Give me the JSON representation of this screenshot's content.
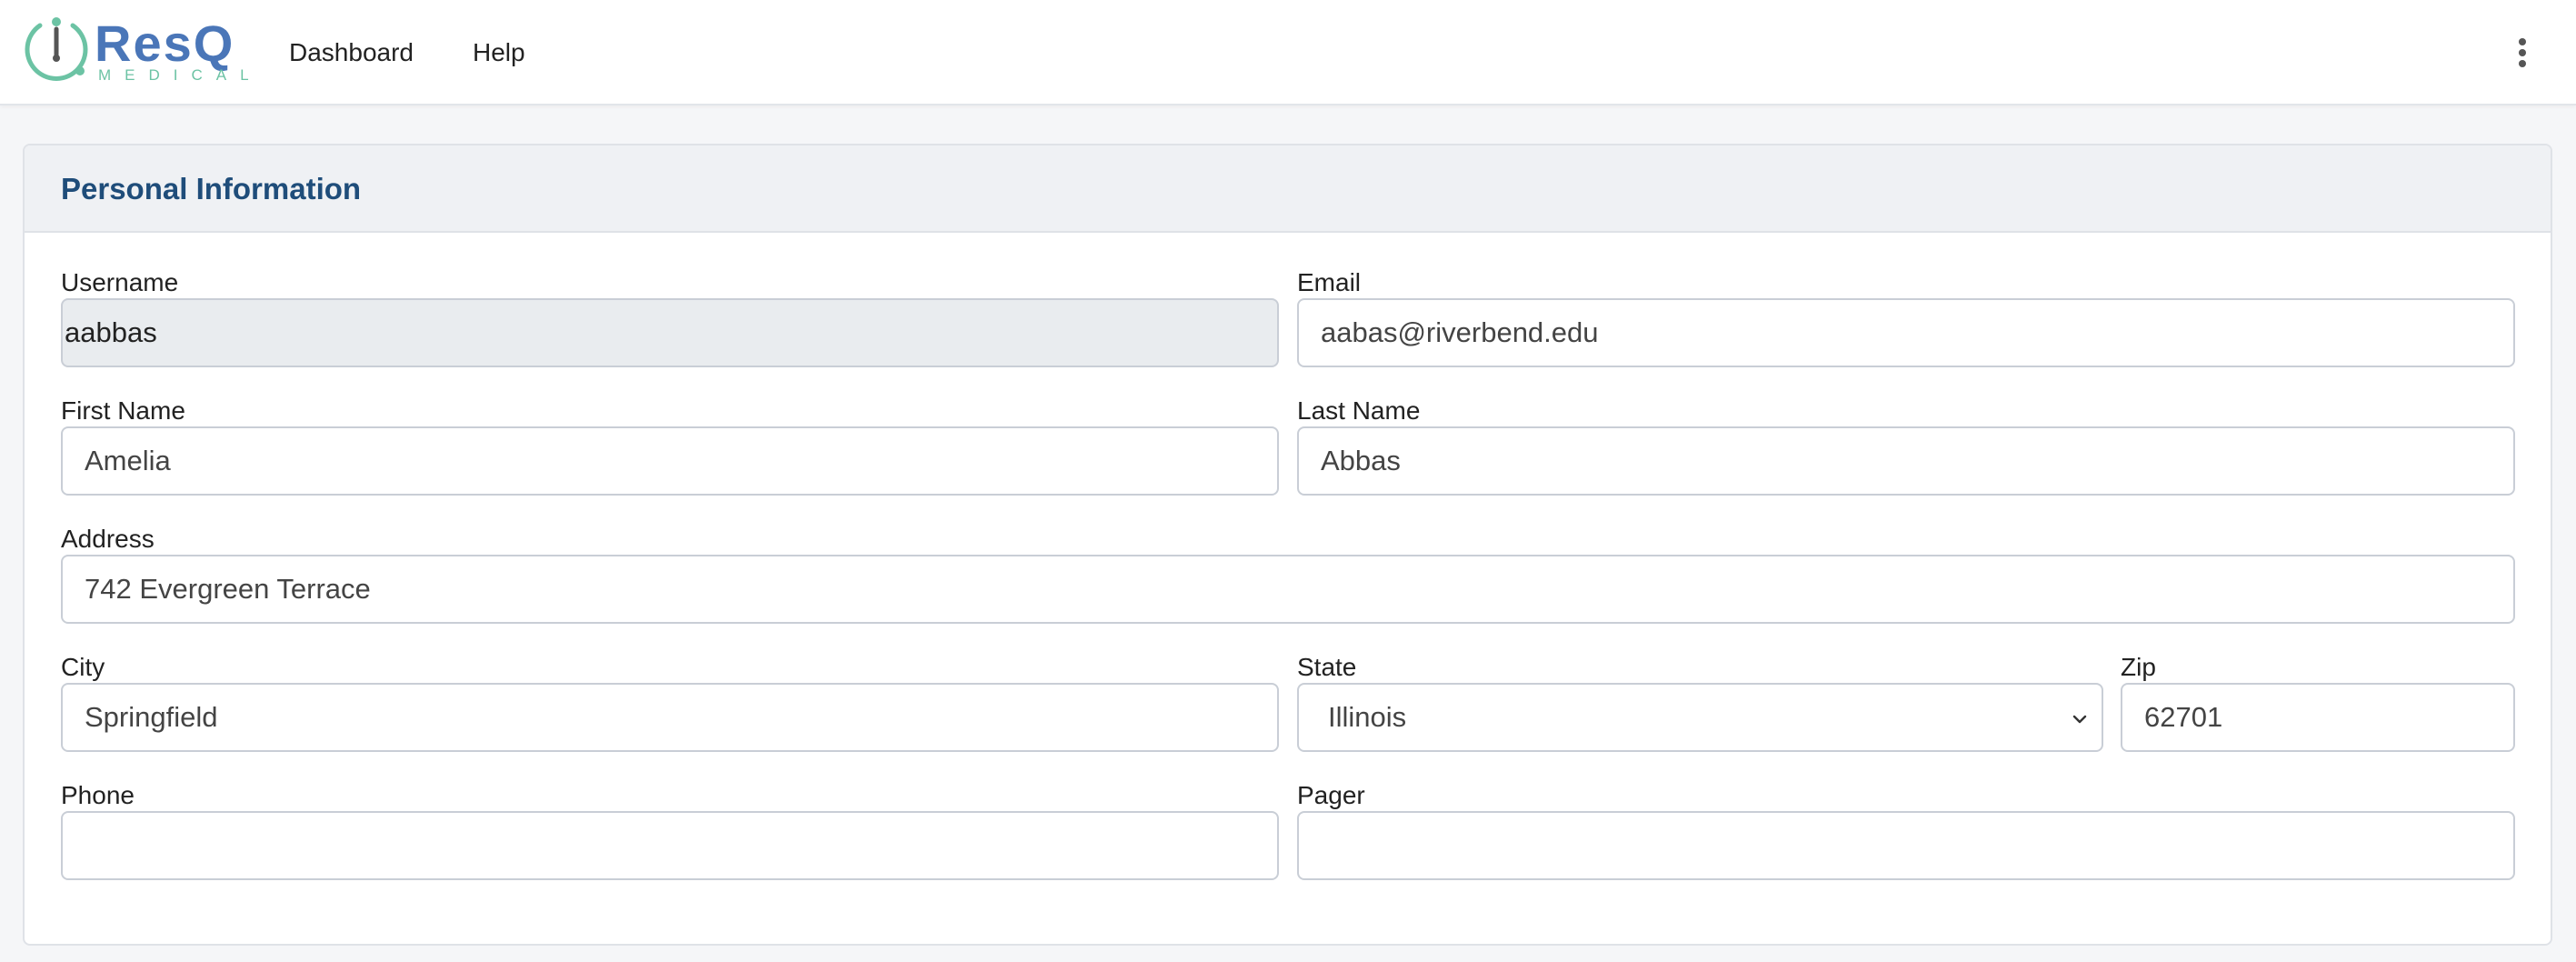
{
  "brand": {
    "name": "ResQ",
    "subtitle": "MEDICAL",
    "primary_color": "#4a76b8",
    "accent_color": "#6cc3a4"
  },
  "nav": {
    "items": [
      {
        "label": "Dashboard"
      },
      {
        "label": "Help"
      }
    ],
    "menu_icon": "kebab-menu-icon"
  },
  "card": {
    "title": "Personal Information",
    "title_color": "#1f4d7a"
  },
  "form": {
    "username": {
      "label": "Username",
      "value": "aabbas",
      "readonly": true
    },
    "email": {
      "label": "Email",
      "value": "aabas@riverbend.edu"
    },
    "first_name": {
      "label": "First Name",
      "value": "Amelia"
    },
    "last_name": {
      "label": "Last Name",
      "value": "Abbas"
    },
    "address": {
      "label": "Address",
      "value": "742 Evergreen Terrace"
    },
    "city": {
      "label": "City",
      "value": "Springfield"
    },
    "state": {
      "label": "State",
      "value": "Illinois",
      "icon": "chevron-down-icon"
    },
    "zip": {
      "label": "Zip",
      "value": "62701"
    },
    "phone": {
      "label": "Phone",
      "value": ""
    },
    "pager": {
      "label": "Pager",
      "value": ""
    }
  }
}
